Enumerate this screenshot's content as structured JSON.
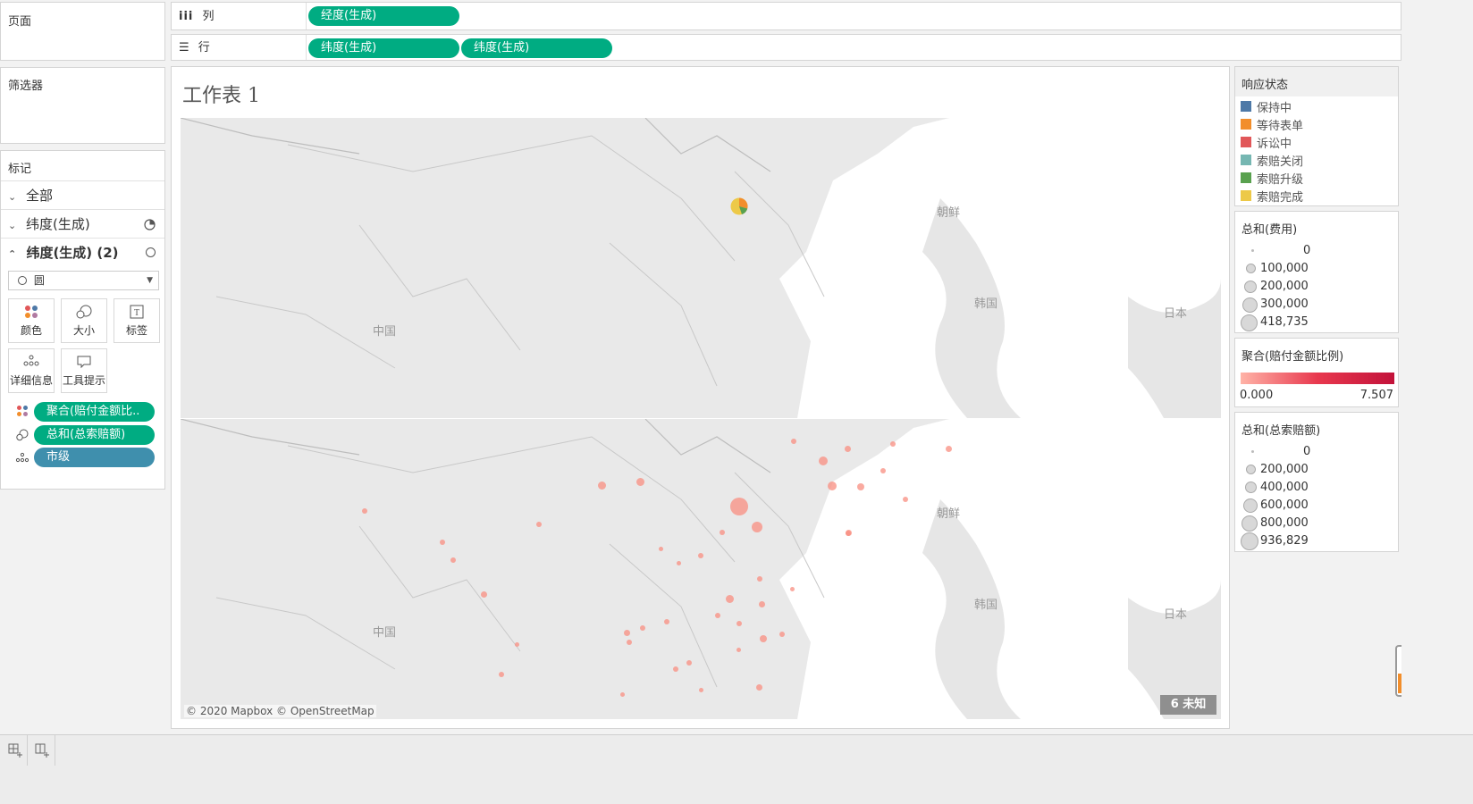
{
  "sidebar": {
    "pages_title": "页面",
    "filters_title": "筛选器",
    "marks_title": "标记",
    "marks_rows": [
      {
        "label": "全部"
      },
      {
        "label": "纬度(生成)"
      },
      {
        "label": "纬度(生成) (2)"
      }
    ],
    "mark_type": "圆",
    "mark_buttons": [
      {
        "label": "颜色",
        "icon": "color-icon"
      },
      {
        "label": "大小",
        "icon": "size-icon"
      },
      {
        "label": "标签",
        "icon": "label-icon"
      },
      {
        "label": "详细信息",
        "icon": "detail-icon"
      },
      {
        "label": "工具提示",
        "icon": "tooltip-icon"
      }
    ],
    "mark_pills": [
      {
        "label": "聚合(赔付金额比..",
        "icon": "color-icon"
      },
      {
        "label": "总和(总索赔额)",
        "icon": "size-icon"
      },
      {
        "label": "市级",
        "icon": "detail-icon"
      }
    ]
  },
  "shelves": {
    "columns_label": "列",
    "columns_pills": [
      "经度(生成)"
    ],
    "rows_label": "行",
    "rows_pills": [
      "纬度(生成)",
      "纬度(生成)"
    ]
  },
  "worksheet": {
    "title": "工作表 1",
    "attribution": "© 2020 Mapbox © OpenStreetMap",
    "unknown_badge": "6 未知",
    "map_labels": {
      "china": "中国",
      "korea_n": "朝鲜",
      "korea_s": "韩国",
      "japan": "日本"
    }
  },
  "legends": {
    "status": {
      "title": "响应状态",
      "items": [
        {
          "label": "保持中",
          "color": "#4e79a7"
        },
        {
          "label": "等待表单",
          "color": "#f28e2b"
        },
        {
          "label": "诉讼中",
          "color": "#e15759"
        },
        {
          "label": "索赔关闭",
          "color": "#76b7b2"
        },
        {
          "label": "索赔升级",
          "color": "#59a14f"
        },
        {
          "label": "索赔完成",
          "color": "#edc948"
        }
      ]
    },
    "cost": {
      "title": "总和(费用)",
      "items": [
        "0",
        "100,000",
        "200,000",
        "300,000",
        "418,735"
      ]
    },
    "ratio": {
      "title": "聚合(赔付金额比例)",
      "min": "0.000",
      "max": "7.507",
      "color_from": "#ffb3a7",
      "color_to": "#c2123a"
    },
    "claims": {
      "title": "总和(总索赔额)",
      "items": [
        "0",
        "200,000",
        "400,000",
        "600,000",
        "800,000",
        "936,829"
      ]
    }
  }
}
